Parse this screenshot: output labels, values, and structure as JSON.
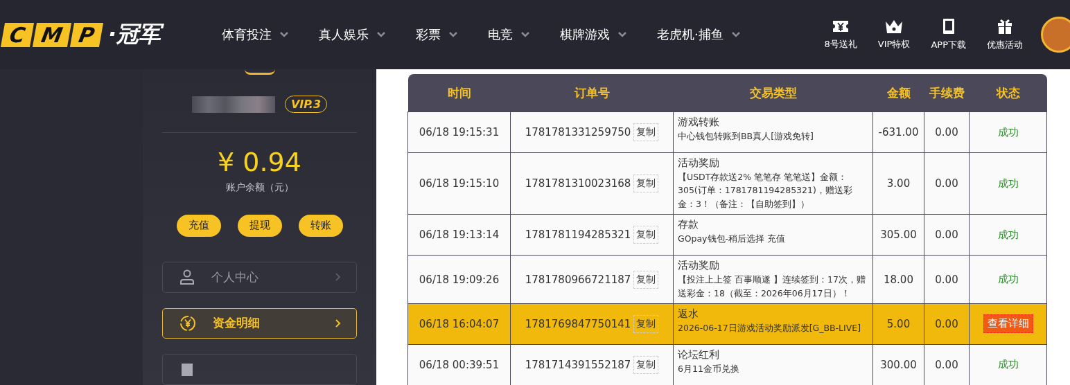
{
  "logo": {
    "mark": [
      "C",
      "M",
      "P"
    ],
    "name": "·冠军"
  },
  "nav": [
    {
      "label": "体育投注"
    },
    {
      "label": "真人娱乐"
    },
    {
      "label": "彩票"
    },
    {
      "label": "电竞"
    },
    {
      "label": "棋牌游戏"
    },
    {
      "label": "老虎机·捕鱼"
    }
  ],
  "quick_links": [
    {
      "kind": "ticket",
      "label": "8号送礼"
    },
    {
      "kind": "crown",
      "label": "VIP特权"
    },
    {
      "kind": "tablet",
      "label": "APP下载"
    },
    {
      "kind": "gift",
      "label": "优惠活动"
    }
  ],
  "account": {
    "vip": "VIP.3",
    "balance": "¥ 0.94",
    "balance_label": "账户余额（元）",
    "actions": [
      "充值",
      "提现",
      "转账"
    ]
  },
  "menu": [
    {
      "kind": "person",
      "label": "个人中心",
      "selected": false
    },
    {
      "kind": "coin",
      "label": "资金明细",
      "selected": true
    },
    {
      "kind": "doc",
      "selected": false
    }
  ],
  "table": {
    "columns": [
      "时间",
      "订单号",
      "交易类型",
      "金额",
      "手续费",
      "状态"
    ],
    "rows": [
      {
        "time": "06/18 19:15:31",
        "order": "1781781331259750",
        "copy": "复制",
        "type": "游戏转账",
        "detail": "中心钱包转账到BB真人[游戏免转]",
        "amount": "-631.00",
        "fee": "0.00",
        "status": {
          "kind": "text",
          "label": "成功"
        },
        "selected": false
      },
      {
        "time": "06/18 19:15:10",
        "order": "1781781310023168",
        "copy": "复制",
        "type": "活动奖励",
        "detail": "【USDT存款送2% 笔笔存 笔笔送】金额：305(订单：1781781194285321)，赠送彩金：3！（备注：【自助签到】）",
        "amount": "3.00",
        "fee": "0.00",
        "status": {
          "kind": "text",
          "label": "成功"
        },
        "selected": false
      },
      {
        "time": "06/18 19:13:14",
        "order": "1781781194285321",
        "copy": "复制",
        "type": "存款",
        "detail": "GOpay钱包-稍后选择 充值",
        "amount": "305.00",
        "fee": "0.00",
        "status": {
          "kind": "text",
          "label": "成功"
        },
        "selected": false
      },
      {
        "time": "06/18 19:09:26",
        "order": "1781780966721187",
        "copy": "复制",
        "type": "活动奖励",
        "detail": "【投注上上签 百事顺遂 】连续签到：17次，赠送彩金：18（截至：2026年06月17日）！",
        "amount": "18.00",
        "fee": "0.00",
        "status": {
          "kind": "text",
          "label": "成功"
        },
        "selected": false
      },
      {
        "time": "06/18 16:04:07",
        "order": "1781769847750141",
        "copy": "复制",
        "type": "返水",
        "detail": "2026-06-17日游戏活动奖励派发[G_BB-LIVE]",
        "amount": "5.00",
        "fee": "0.00",
        "status": {
          "kind": "button",
          "label": "查看详细"
        },
        "selected": true
      },
      {
        "time": "06/18 00:39:51",
        "order": "1781714391552187",
        "copy": "复制",
        "type": "论坛红利",
        "detail": "6月11金币兑换",
        "amount": "300.00",
        "fee": "0.00",
        "status": {
          "kind": "text",
          "label": "成功"
        },
        "selected": false
      }
    ]
  }
}
